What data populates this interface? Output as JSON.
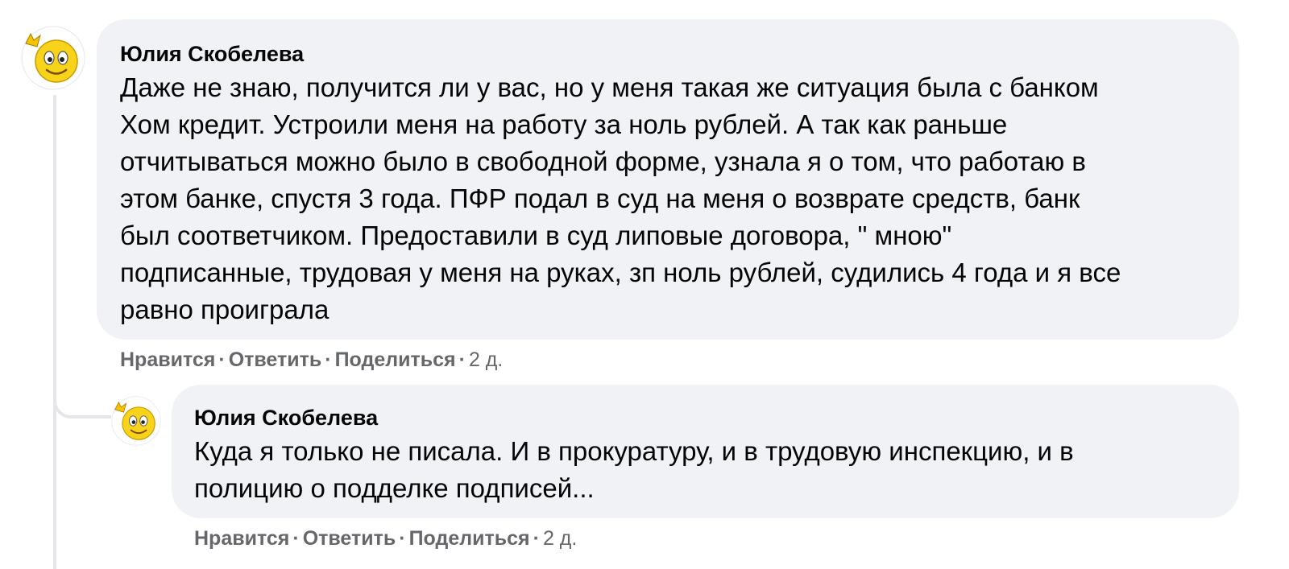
{
  "comments": [
    {
      "author": "Юлия Скобелева",
      "text": "Даже не знаю, получится ли у вас, но у меня такая же ситуация была с банком\nХом кредит. Устроили меня на работу за ноль рублей. А так как раньше\nотчитываться можно было в свободной форме, узнала я о том, что работаю в\nэтом банке, спустя 3 года. ПФР подал в суд на меня о возврате средств, банк\nбыл соответчиком. Предоставили в суд липовые договора, \" мною\"\nподписанные, трудовая у меня на руках, зп ноль рублей, судились 4 года и я все\nравно проиграла",
      "actions": {
        "like": "Нравится",
        "reply": "Ответить",
        "share": "Поделиться",
        "separator": "·",
        "time": "2 д."
      }
    },
    {
      "author": "Юлия Скобелева",
      "text": "Куда я только не писала. И в прокуратуру, и в трудовую инспекцию, и в\nполицию о подделке подписей...",
      "actions": {
        "like": "Нравится",
        "reply": "Ответить",
        "share": "Поделиться",
        "separator": "·",
        "time": "2 д."
      }
    }
  ],
  "avatar_icon": "smiley-face-icon",
  "colors": {
    "bubble": "#f0f2f5",
    "text": "#050505",
    "secondary": "#65676b",
    "thread_line": "#e4e6eb"
  }
}
